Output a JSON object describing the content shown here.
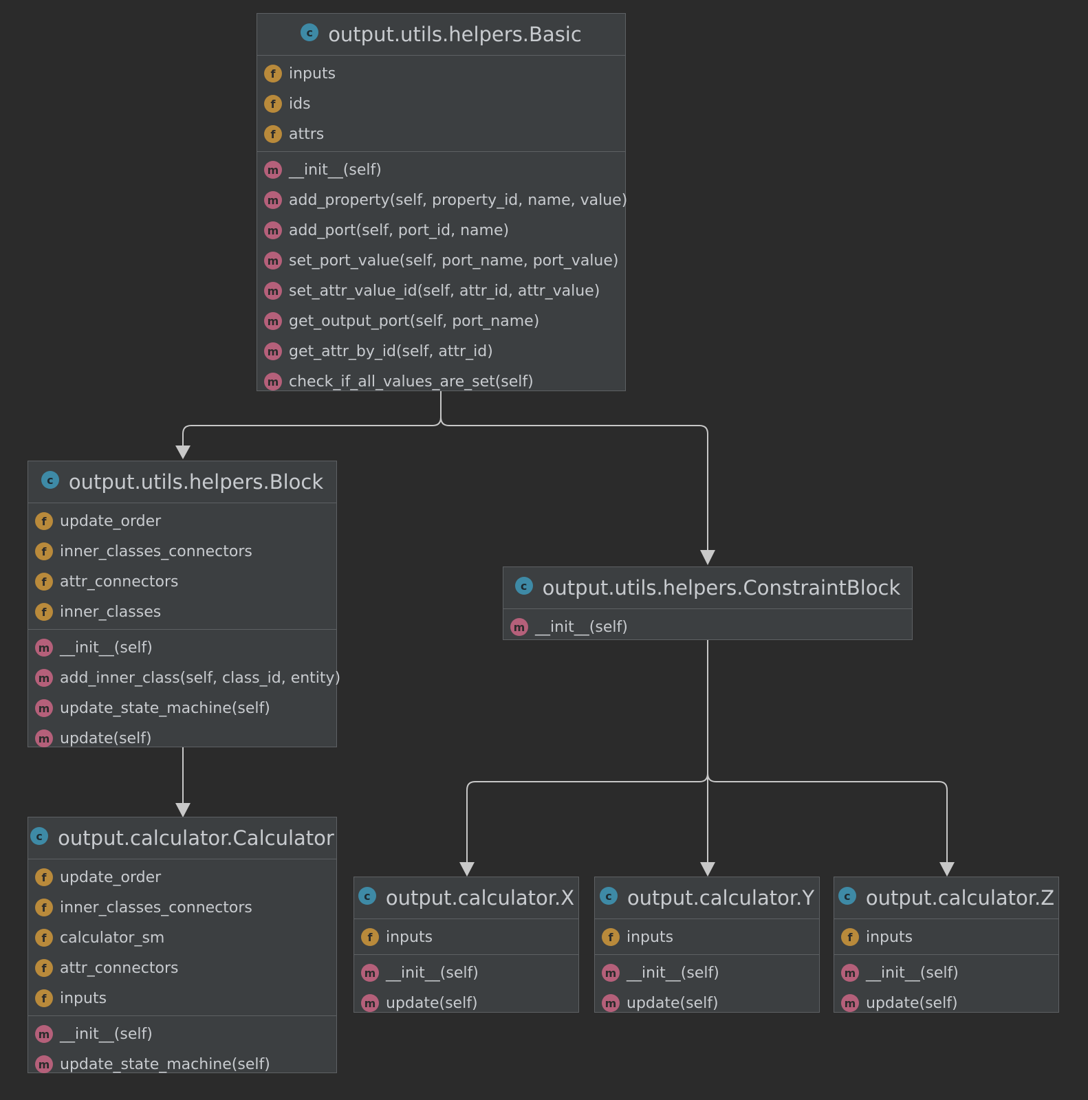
{
  "colors": {
    "background": "#2b2b2b",
    "box": "#3c3f41",
    "border": "#5e6164",
    "text": "#c8cbcf",
    "class_badge": "#3e8aa6",
    "field_badge": "#b98a3b",
    "method_badge": "#b5607a",
    "edge": "#c8c8c8"
  },
  "badge_letters": {
    "class": "c",
    "field": "f",
    "method": "m"
  },
  "classes": {
    "basic": {
      "name": "output.utils.helpers.Basic",
      "fields": [
        "inputs",
        "ids",
        "attrs"
      ],
      "methods": [
        "__init__(self)",
        "add_property(self, property_id, name, value)",
        "add_port(self, port_id, name)",
        "set_port_value(self, port_name, port_value)",
        "set_attr_value_id(self, attr_id, attr_value)",
        "get_output_port(self, port_name)",
        "get_attr_by_id(self, attr_id)",
        "check_if_all_values_are_set(self)"
      ]
    },
    "block": {
      "name": "output.utils.helpers.Block",
      "fields": [
        "update_order",
        "inner_classes_connectors",
        "attr_connectors",
        "inner_classes"
      ],
      "methods": [
        "__init__(self)",
        "add_inner_class(self, class_id, entity)",
        "update_state_machine(self)",
        "update(self)"
      ]
    },
    "constraint": {
      "name": "output.utils.helpers.ConstraintBlock",
      "fields": [],
      "methods": [
        "__init__(self)"
      ]
    },
    "calculator": {
      "name": "output.calculator.Calculator",
      "fields": [
        "update_order",
        "inner_classes_connectors",
        "calculator_sm",
        "attr_connectors",
        "inputs"
      ],
      "methods": [
        "__init__(self)",
        "update_state_machine(self)"
      ]
    },
    "x": {
      "name": "output.calculator.X",
      "fields": [
        "inputs"
      ],
      "methods": [
        "__init__(self)",
        "update(self)"
      ]
    },
    "y": {
      "name": "output.calculator.Y",
      "fields": [
        "inputs"
      ],
      "methods": [
        "__init__(self)",
        "update(self)"
      ]
    },
    "z": {
      "name": "output.calculator.Z",
      "fields": [
        "inputs"
      ],
      "methods": [
        "__init__(self)",
        "update(self)"
      ]
    }
  },
  "inheritance": [
    {
      "parent": "basic",
      "child": "block"
    },
    {
      "parent": "basic",
      "child": "constraint"
    },
    {
      "parent": "block",
      "child": "calculator"
    },
    {
      "parent": "constraint",
      "child": "x"
    },
    {
      "parent": "constraint",
      "child": "y"
    },
    {
      "parent": "constraint",
      "child": "z"
    }
  ]
}
